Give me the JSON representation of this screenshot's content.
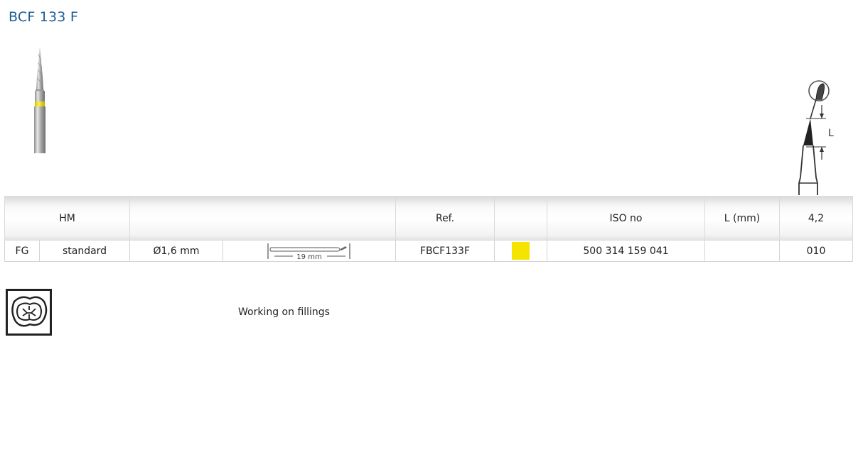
{
  "product": {
    "title": "BCF 133 F"
  },
  "table": {
    "header": {
      "material": "HM",
      "ref_label": "Ref.",
      "iso_label": "ISO no",
      "length_label": "L (mm)",
      "size": "4,2"
    },
    "row": {
      "shank": "FG",
      "variant": "standard",
      "diameter": "Ø1,6 mm",
      "total_length": "19 mm",
      "ref": "FBCF133F",
      "color_code": "#f5e400",
      "iso": "500 314 159 041",
      "length_value": "",
      "size_code": "010"
    }
  },
  "application": {
    "text": "Working on fillings",
    "icon": "tooth-filling-icon"
  },
  "diagram": {
    "label": "L"
  }
}
